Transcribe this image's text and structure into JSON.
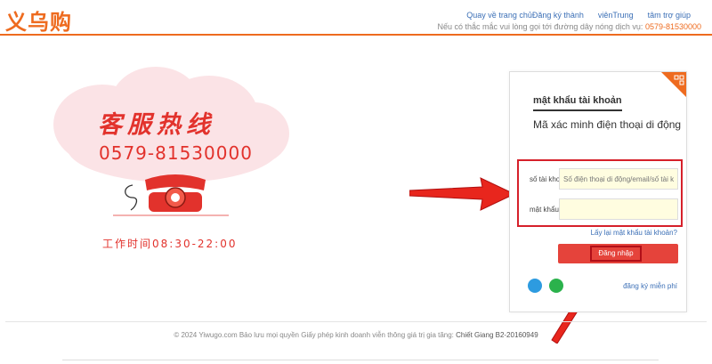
{
  "header": {
    "logo": "义乌购",
    "links": [
      "Quay về trang chủ",
      "Đăng ký thành",
      "viênTrung",
      "tâm trợ giúp"
    ],
    "helpline_text": "Nếu có thắc mắc vui lòng gọi tới đường dây nóng dịch vụ:",
    "helpline_phone": "0579-81530000"
  },
  "promo": {
    "title": "客服热线",
    "phone": "0579-81530000",
    "hours": "工作时间08:30-22:00"
  },
  "login": {
    "tab_title": "mật khẩu tài khoản",
    "subtitle": "Mã xác minh điện thoại di động",
    "account_label": "số tài khoản",
    "account_placeholder": "Số điện thoại di động/email/số tài khoản",
    "password_label": "mật khẩu",
    "forgot_link": "Lấy lại mật khẩu tài khoản?",
    "login_button": "Đăng nhập",
    "register_link": "đăng ký miễn phí"
  },
  "footer": {
    "copyright": "© 2024 Yiwugo.com Bảo lưu mọi quyền Giấy phép kinh doanh viễn thông giá trị gia tăng:",
    "license": "Chiết Giang B2-20160949"
  },
  "colors": {
    "brand": "#ee6b1f",
    "accent_red": "#e2322c",
    "link": "#3b6fb6",
    "highlight": "#d6202a"
  }
}
